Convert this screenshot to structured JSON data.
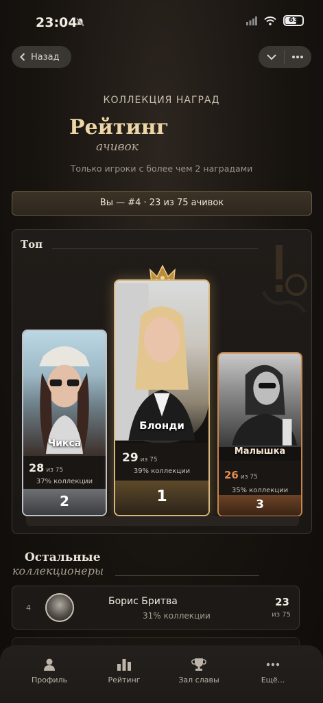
{
  "status": {
    "time": "23:04",
    "battery": "63"
  },
  "nav": {
    "back_label": "Назад"
  },
  "header": {
    "eyebrow": "КОЛЛЕКЦИЯ НАГРАД",
    "title": "Рейтинг",
    "subtitle": "ачивок",
    "caption": "Только игроки с более чем 2 наградами",
    "rank_banner": "Вы — #4 · 23 из 75 ачивок"
  },
  "top": {
    "label": "Топ",
    "podium": [
      {
        "place": "2",
        "name": "Чикса",
        "score": "28",
        "of": "из 75",
        "pct": "37% коллекции",
        "tier": "silver"
      },
      {
        "place": "1",
        "name": "Блонди",
        "score": "29",
        "of": "из 75",
        "pct": "39% коллекции",
        "tier": "gold"
      },
      {
        "place": "3",
        "name": "Малышка",
        "score": "26",
        "of": "из 75",
        "pct": "35% коллекции",
        "tier": "bronze"
      }
    ]
  },
  "others": {
    "title": "Остальные",
    "subtitle": "коллекционеры",
    "rows": [
      {
        "rank": "4",
        "name": "Борис Бритва",
        "pct": "31% коллекции",
        "score": "23",
        "of": "из 75"
      }
    ]
  },
  "bottom_nav": {
    "items": [
      {
        "label": "Профиль",
        "icon": "person-icon"
      },
      {
        "label": "Рейтинг",
        "icon": "bar-chart-icon"
      },
      {
        "label": "Зал славы",
        "icon": "trophy-icon"
      },
      {
        "label": "Ещё...",
        "icon": "more-dots-icon"
      }
    ]
  },
  "colors": {
    "gold": "#d9b77a",
    "silver": "#bfc3c9",
    "bronze": "#c7874c",
    "accent_title": "#ecd6a6"
  }
}
